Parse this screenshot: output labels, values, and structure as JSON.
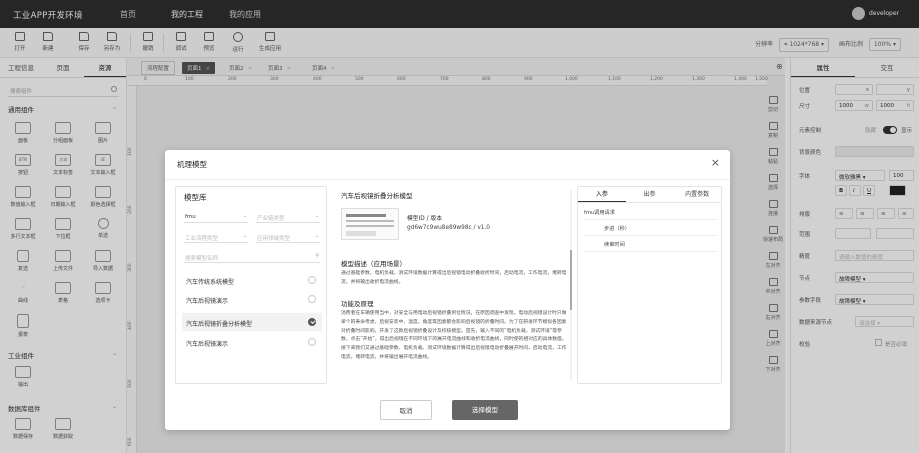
{
  "topbar": {
    "brand": "工业APP开发环境",
    "nav": [
      "首页",
      "我的工程",
      "我的应用"
    ],
    "user": "developer"
  },
  "toolbar": {
    "items": [
      "打开",
      "新建",
      "保存",
      "另存为",
      "撤销",
      "调试",
      "预览",
      "运行",
      "生成应用"
    ],
    "resolution_label": "分辨率",
    "resolution_value": "1024*768",
    "zoom_label": "画布比例",
    "zoom_value": "100%"
  },
  "leftpanel": {
    "tabs": [
      "工程信息",
      "页面",
      "资源"
    ],
    "search_placeholder": "搜索组件",
    "groups": [
      "通用组件",
      "工业组件",
      "数据库组件"
    ],
    "components_general": [
      "面板",
      "分组面板",
      "图片",
      "按钮",
      "文本标签",
      "文本输入框",
      "数值输入框",
      "日期输入框",
      "颜色选择框",
      "多行文本框",
      "下拉框",
      "单选",
      "复选",
      "上传文件",
      "导入数据",
      "曲线",
      "表格",
      "选项卡",
      "报表"
    ],
    "component_icon_text": [
      "BTN",
      "文本",
      "IE"
    ],
    "components_industry": [
      "输出"
    ],
    "components_db": [
      "数据保存",
      "数据获取"
    ]
  },
  "canvas": {
    "tabs": [
      "流程配置",
      "页面1",
      "页面2",
      "页面3",
      "页面4"
    ],
    "hruler": [
      "0",
      "100",
      "200",
      "300",
      "400",
      "500",
      "600",
      "700",
      "800",
      "900",
      "1,000",
      "1,100",
      "1,200",
      "1,300",
      "1,400",
      "1,500"
    ],
    "vruler": [
      "100",
      "200",
      "300",
      "400",
      "500",
      "600"
    ]
  },
  "sidetools": [
    "剪切",
    "复制",
    "粘贴",
    "选择",
    "连接",
    "快速布局",
    "左对齐",
    "中对齐",
    "右对齐",
    "上对齐",
    "下对齐"
  ],
  "rightpanel": {
    "tabs": [
      "属性",
      "交互"
    ],
    "position_label": "位置",
    "x": "x",
    "y": "y",
    "size_label": "尺寸",
    "w_value": "1000",
    "w": "w",
    "h_value": "1000",
    "h": "h",
    "elem_ctrl_label": "元素控制",
    "elem_ctrl_off": "隐藏",
    "elem_ctrl_on": "显示",
    "bg_label": "背景颜色",
    "font_label": "字体",
    "font_value": "微软雅黑",
    "font_size": "100",
    "font_styles": [
      "B",
      "I",
      "U"
    ],
    "align_label": "排版",
    "range_label": "范围",
    "precision_label": "精度",
    "precision_placeholder": "请输入数值的精度",
    "node_label": "节点",
    "node_value": "故障模型",
    "param_field_label": "参数字段",
    "param_field_value": "故障模型",
    "db_node_label": "数据来源节点",
    "db_node_value": "请选择",
    "validate_label": "校验",
    "validate_value": "是否必填"
  },
  "modal": {
    "title": "机理模型",
    "close": "×",
    "lib_title": "模型库",
    "filter1": "fmu",
    "filter2": "产业链类型",
    "filter3": "工业流程类型",
    "filter4": "应用领域类型",
    "search_placeholder": "搜索模型名称",
    "models": [
      "汽车传统系统模型",
      "汽车后视镜演示",
      "汽车后视镜折叠分析模型",
      "汽车后视镜演示"
    ],
    "selected_index": 2,
    "detail_title": "汽车后视镜折叠分析模型",
    "model_id_label": "模型ID / 版本",
    "model_id_value": "gd6w7c9wu8e89w98c / v1.0",
    "desc_heading": "模型描述（应用场景）",
    "desc_text": "通过基础参数，电机负载，测试环境数据计算得出后视镜电动折叠收折时间，启动电流，工作电流，堵转电流，并将输出收折电流曲线。",
    "func_heading": "功能及原理",
    "func_text": "消费者在车辆使用当中，对安全与用电动后视镜折叠到位情况，在原因调查中发现，电动后视镜设计时只做单个的寿命考虑，后视安装中，温度，角度等因素都会影响后视镜的折叠时间。为了在研发环节模拟各因素对折叠时间影响，开发了这款后视镜折叠设计及校核模型。首先，输入不同的“电机负载，测试环境”等参数，点击“开始”，得出后视镜在不同环境下的展开电流曲线和收折电流曲线，同时使的相对应的具体数值。接下来我们又通过基础参数、电机负载、测试环境数据计算得出后视镜电动折叠展开时间，启动电流，工作电流，堵转电流，并将输出展开电流曲线。",
    "param_tabs": [
      "入参",
      "出参",
      "内置参数"
    ],
    "param_rows": [
      "fmu调用请求",
      "步进（秒）",
      "续审时间"
    ],
    "cancel": "取消",
    "ok": "选择模型"
  }
}
